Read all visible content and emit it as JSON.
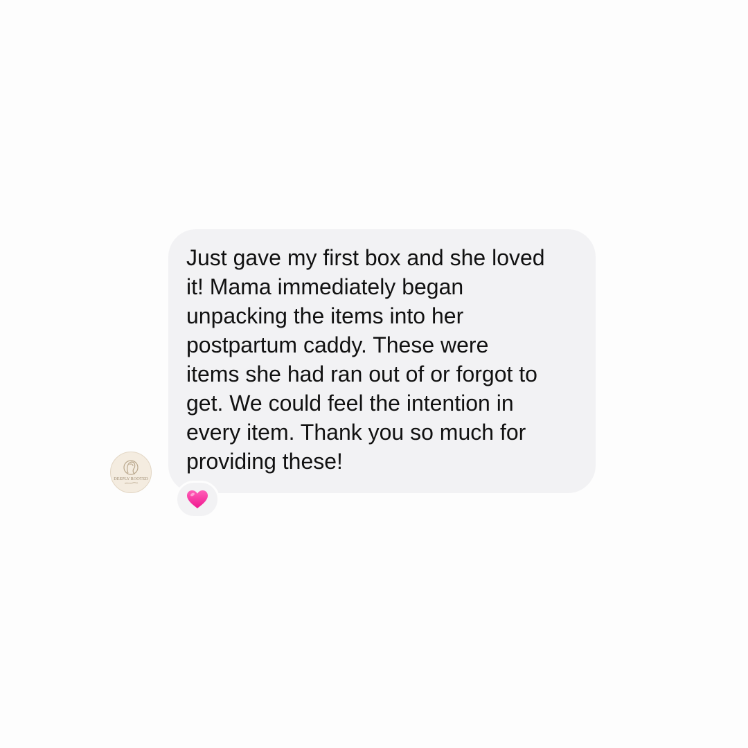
{
  "conversation": {
    "message": {
      "lines": [
        "Just gave my first box and she loved",
        "it! Mama immediately began",
        "unpacking the items into her",
        "postpartum caddy. These were",
        "items she had ran out of or forgot to",
        "get. We could feel the intention in",
        "every item. Thank you so much for",
        "providing these!"
      ],
      "bubble_color": "#f2f2f4",
      "text_color": "#111111"
    },
    "avatar": {
      "logo_text": "DEEPLY ROOTED",
      "icon": "woman-profile-logo-icon",
      "background_color": "#f4ece0"
    },
    "reaction": {
      "icon": "pink-heart-icon",
      "color": "#ff3ea5"
    }
  }
}
